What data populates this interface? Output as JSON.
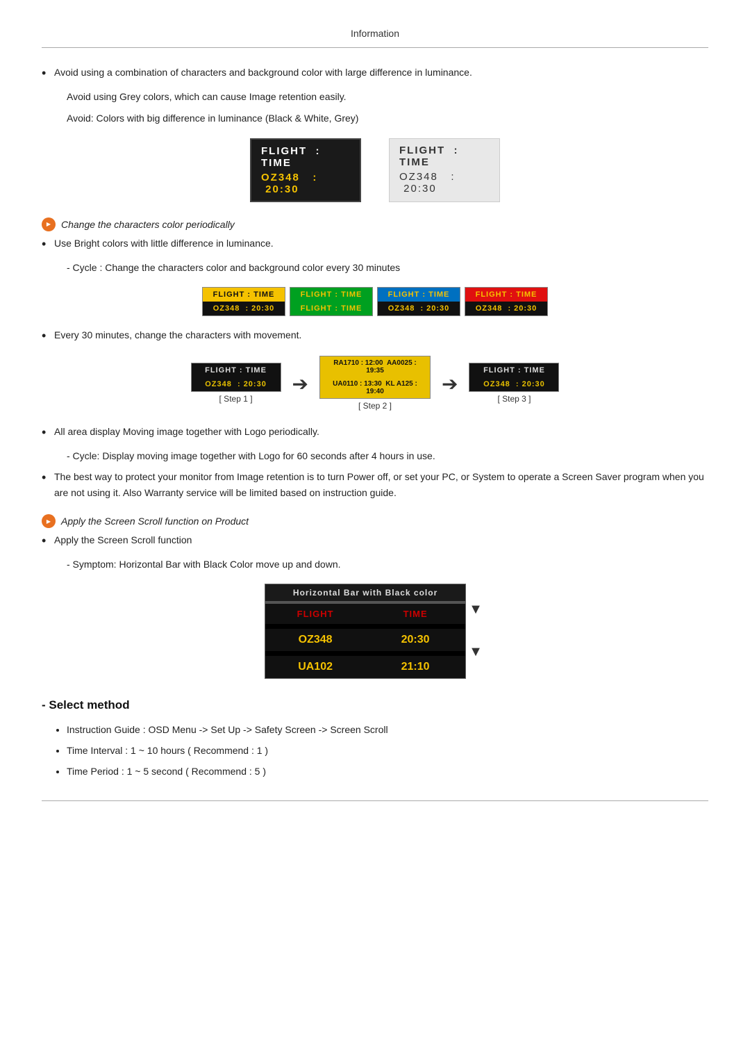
{
  "page": {
    "title": "Information",
    "bullet1": "Avoid using a combination of characters and background color with large difference in luminance.",
    "sub1": "Avoid using Grey colors, which can cause Image retention easily.",
    "sub2": "Avoid: Colors with big difference in luminance (Black & White, Grey)",
    "icon1_text": "Change the characters color periodically",
    "bullet2": "Use Bright colors with little difference in luminance.",
    "sub3": "- Cycle : Change the characters color and background color every 30 minutes",
    "bullet3": "Every 30 minutes, change the characters with movement.",
    "bullet4": "All area display Moving image together with Logo periodically.",
    "sub4": "- Cycle: Display moving image together with Logo for 60 seconds after 4 hours in use.",
    "bullet5": "The best way to protect your monitor from Image retention is to turn Power off, or set your PC, or System to operate a Screen Saver program when you are not using it. Also Warranty service will be limited based on instruction guide.",
    "icon2_text": "Apply the Screen Scroll function on Product",
    "bullet6": "Apply the Screen Scroll function",
    "sub5": "- Symptom: Horizontal Bar with Black Color move up and down.",
    "hbar_title": "Horizontal Bar with Black color",
    "hbar_col1": "FLIGHT",
    "hbar_col2": "TIME",
    "hbar_r1c1": "OZ348",
    "hbar_r1c2": "20:30",
    "hbar_r2c1": "UA102",
    "hbar_r2c2": "21:10",
    "select_method": "- Select method",
    "select1": "Instruction Guide : OSD Menu -> Set Up -> Safety Screen -> Screen Scroll",
    "select2": "Time Interval : 1 ~ 10 hours ( Recommend : 1 )",
    "select3": "Time Period : 1 ~ 5 second ( Recommend : 5 )",
    "flight_time_label": "FLIGHT  :  TIME",
    "oz348_label": "OZ348   :  20:30",
    "flight_time_label2": "FLIGHT  :  TIME",
    "oz348_label2": "OZ348   :  20:30",
    "cycle_boxes": [
      {
        "top": "FLIGHT : TIME",
        "bot": "OZ348  : 20:30",
        "top_bg": "#e8c000",
        "top_color": "#111",
        "bot_bg": "#111",
        "bot_color": "#e8c000"
      },
      {
        "top": "FLIGHT : TIME",
        "bot": "FLIGHT : TIME",
        "top_bg": "#00a020",
        "top_color": "#e8c000",
        "bot_bg": "#00a020",
        "bot_color": "#e8c000"
      },
      {
        "top": "FLIGHT : TIME",
        "bot": "OZ348  : 20:30",
        "top_bg": "#0070c0",
        "top_color": "#e8c000",
        "bot_bg": "#111",
        "bot_color": "#e8c000"
      },
      {
        "top": "FLIGHT : TIME",
        "bot": "OZ348  : 20:30",
        "top_bg": "#cc0000",
        "top_color": "#e8c000",
        "bot_bg": "#111",
        "bot_color": "#e8c000"
      }
    ],
    "step1_top": "FLIGHT : TIME",
    "step1_bot": "OZ348  : 20:30",
    "step1_label": "[ Step 1 ]",
    "step2_top": "RA1710 : 12:00  AA0025 : 19:35",
    "step2_bot": "UA0110 : 13:30  KL A125 : 19:40",
    "step2_label": "[ Step 2 ]",
    "step3_top": "FLIGHT : TIME",
    "step3_bot": "OZ348  : 20:30",
    "step3_label": "[ Step 3 ]"
  }
}
